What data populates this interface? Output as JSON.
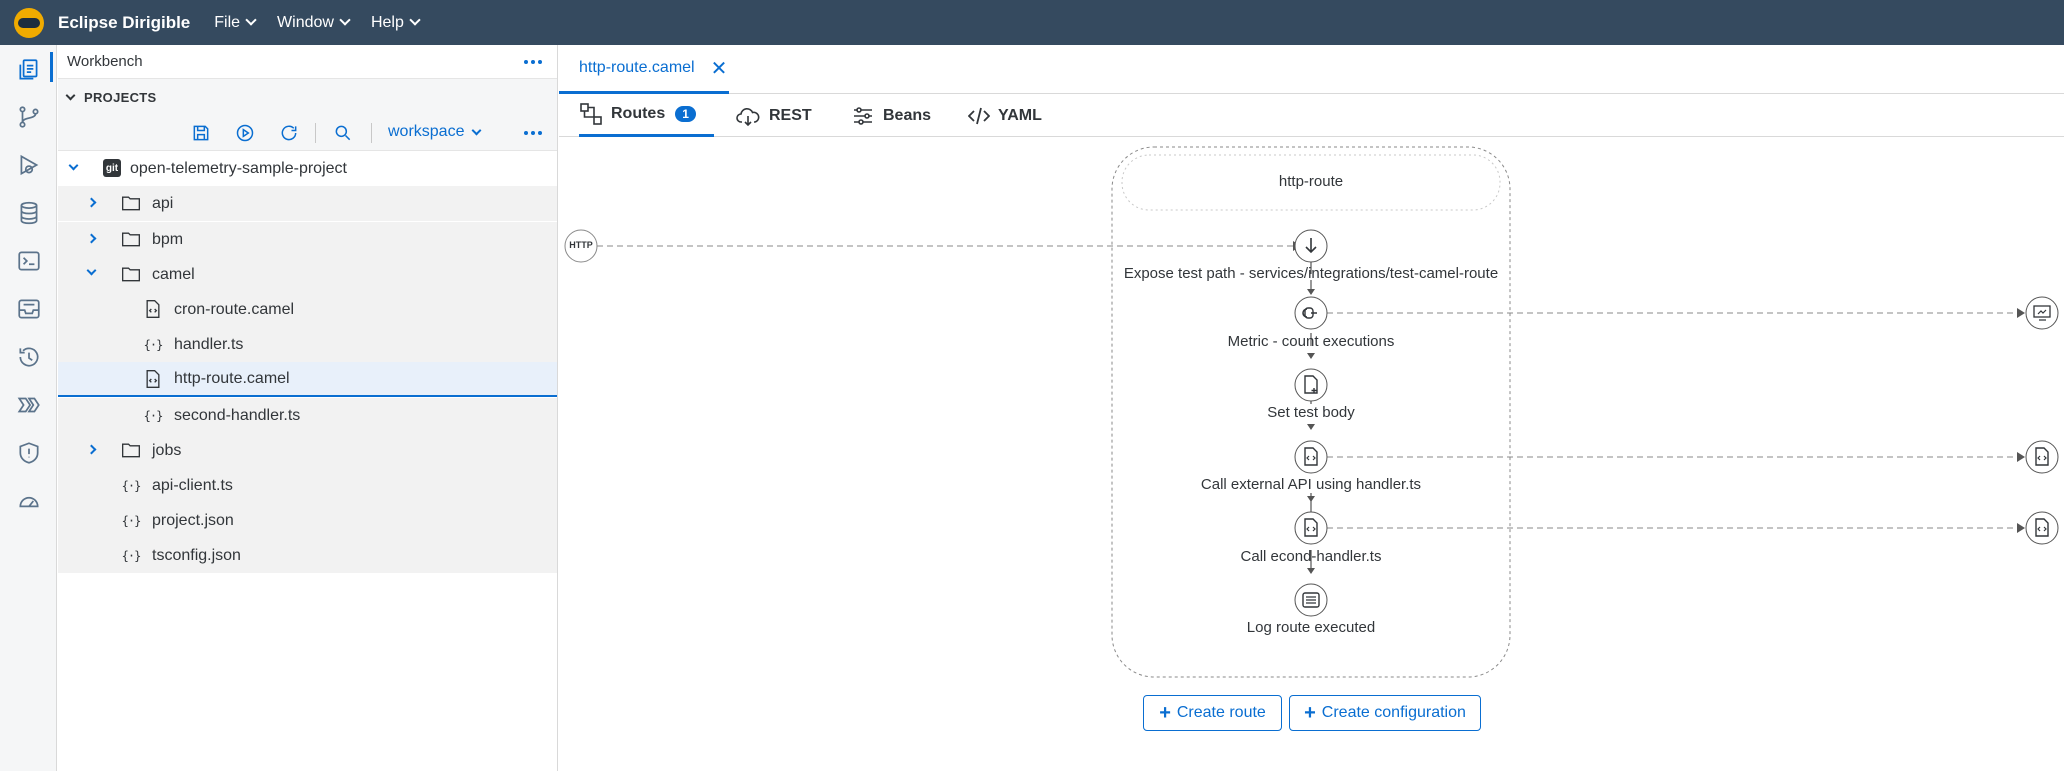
{
  "app": {
    "title": "Eclipse Dirigible"
  },
  "menus": [
    {
      "label": "File"
    },
    {
      "label": "Window"
    },
    {
      "label": "Help"
    }
  ],
  "activity_icons": [
    "projects-icon",
    "git-icon",
    "debug-icon",
    "database-icon",
    "terminal-icon",
    "inbox-icon",
    "history-icon",
    "pipeline-icon",
    "security-icon",
    "dashboard-icon"
  ],
  "explorer": {
    "header": "Workbench",
    "section": "PROJECTS",
    "workspace_label": "workspace",
    "tree": [
      {
        "label": "open-telemetry-sample-project",
        "type": "git",
        "depth": 0,
        "expanded": true
      },
      {
        "label": "api",
        "type": "folder",
        "depth": 1,
        "expanded": false
      },
      {
        "label": "bpm",
        "type": "folder",
        "depth": 1,
        "expanded": false
      },
      {
        "label": "camel",
        "type": "folder",
        "depth": 1,
        "expanded": true
      },
      {
        "label": "cron-route.camel",
        "type": "camel",
        "depth": 2
      },
      {
        "label": "handler.ts",
        "type": "code",
        "depth": 2
      },
      {
        "label": "http-route.camel",
        "type": "camel",
        "depth": 2,
        "selected": true
      },
      {
        "label": "second-handler.ts",
        "type": "code",
        "depth": 2
      },
      {
        "label": "jobs",
        "type": "folder",
        "depth": 1,
        "expanded": false
      },
      {
        "label": "api-client.ts",
        "type": "code",
        "depth": 1
      },
      {
        "label": "project.json",
        "type": "code",
        "depth": 1
      },
      {
        "label": "tsconfig.json",
        "type": "code",
        "depth": 1
      }
    ]
  },
  "editor": {
    "file_tab": "http-route.camel",
    "subtabs": [
      {
        "label": "Routes",
        "badge": "1"
      },
      {
        "label": "REST"
      },
      {
        "label": "Beans"
      },
      {
        "label": "YAML"
      }
    ],
    "route": {
      "name": "http-route",
      "source_badge": "HTTP",
      "steps": [
        "Expose test path - services/integrations/test-camel-route",
        "Metric - count executions",
        "Set test body",
        "Call external API using handler.ts",
        "Call econd-handler.ts",
        "Log route executed"
      ]
    },
    "buttons": {
      "create_route": "Create route",
      "create_configuration": "Create configuration"
    }
  },
  "colors": {
    "shell": "#354a5f",
    "accent": "#0a6ed1",
    "logo": "#f0ab00"
  }
}
